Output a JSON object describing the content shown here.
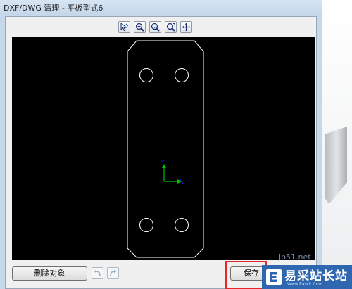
{
  "window": {
    "title": "DXF/DWG 清理 - 平板型式6"
  },
  "toolbar": {
    "buttons": [
      {
        "icon": "select-cursor-icon"
      },
      {
        "icon": "zoom-in-icon"
      },
      {
        "icon": "zoom-area-icon"
      },
      {
        "icon": "zoom-fit-icon"
      },
      {
        "icon": "pan-icon"
      }
    ]
  },
  "buttons": {
    "delete_label": "删除对象",
    "save_label": "保存"
  },
  "colors": {
    "canvas_background": "#000000",
    "drawing_lines": "#ffffff",
    "axis_y": "#00c000",
    "axis_x": "#2020ff",
    "highlight": "#e5262a"
  },
  "watermark": {
    "site_text": "jb51.net",
    "logo_text": "易采站长站",
    "logo_sub": "Www.Easck.Com"
  }
}
